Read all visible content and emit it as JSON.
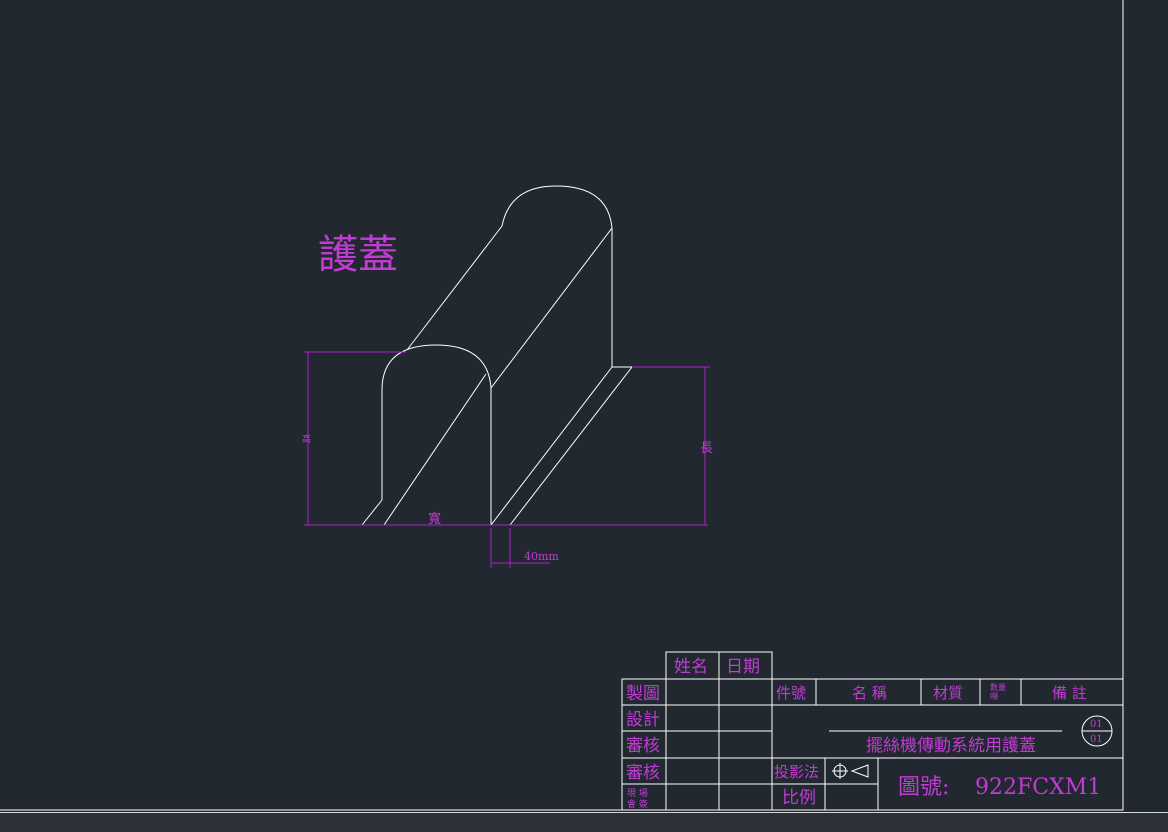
{
  "drawing": {
    "title": "護蓋",
    "dim_height": "高",
    "dim_width": "寬",
    "dim_length": "長",
    "dim_flange": "40mm"
  },
  "title_block": {
    "col_name": "姓名",
    "col_date": "日期",
    "row_drawn": "製圖",
    "row_design": "設計",
    "row_check": "審核",
    "row_approve": "審核",
    "row_field_a": "現 場",
    "row_field_b": "會 簽",
    "part_no": "件號",
    "part_name": "名 稱",
    "material": "材質",
    "qty_a": "數量",
    "qty_b": "噸",
    "remarks": "備 註",
    "drawing_desc": "擺絲機傳動系統用護蓋",
    "sheet_num": "01",
    "sheet_total": "01",
    "projection": "投影法",
    "scale": "比例",
    "drawing_no_label": "圖號:",
    "drawing_no": "922FCXM1"
  },
  "colors": {
    "background": "#212830",
    "annotation": "#c03cd2",
    "lines": "#ffffff"
  }
}
